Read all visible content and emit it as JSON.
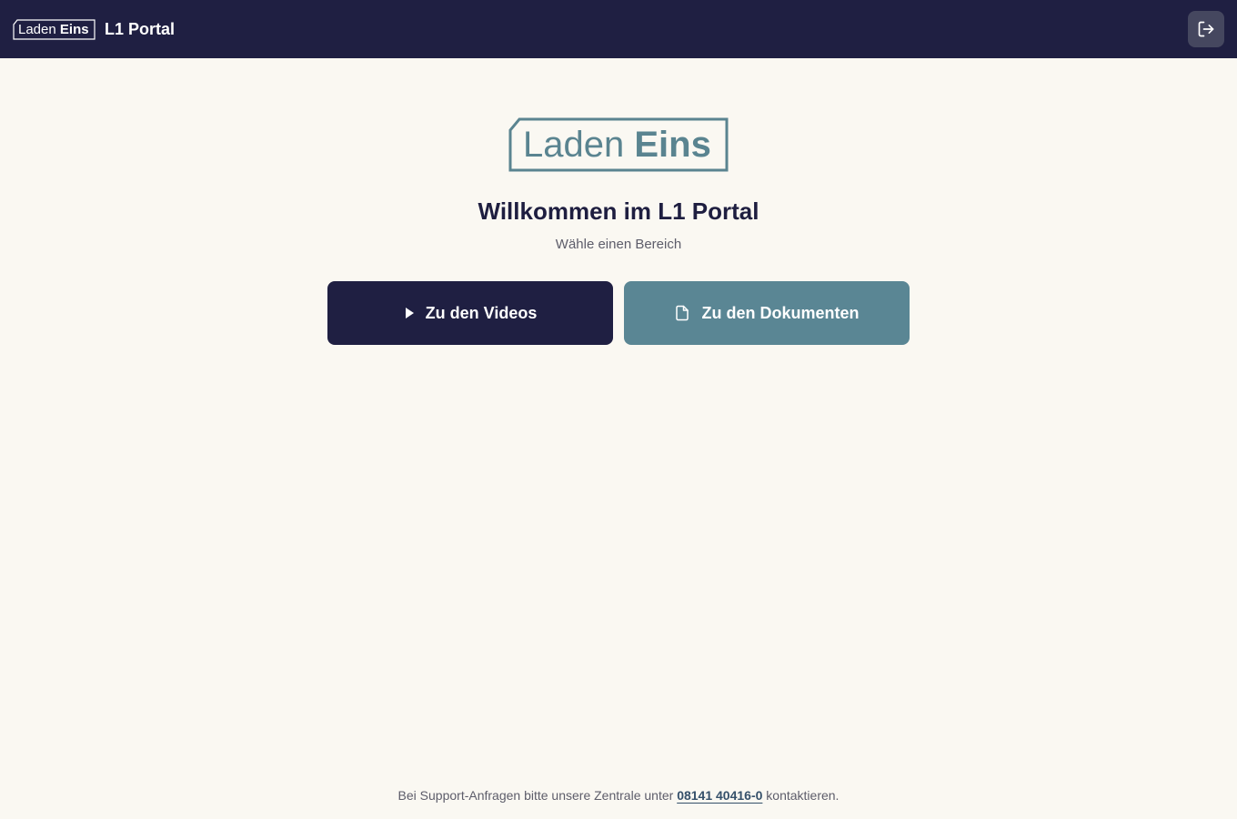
{
  "header": {
    "logo_text_light": "Laden",
    "logo_text_bold": "Eins",
    "app_title": "L1 Portal",
    "logout_icon": "logout-icon"
  },
  "main": {
    "logo_text_light": "Laden",
    "logo_text_bold": "Eins",
    "welcome": "Willkommen im L1 Portal",
    "subtitle": "Wähle einen Bereich",
    "videos_button": {
      "label": "Zu den Videos",
      "icon": "play-icon"
    },
    "docs_button": {
      "label": "Zu den Dokumenten",
      "icon": "document-icon"
    }
  },
  "footer": {
    "text_before": "Bei Support-Anfragen bitte unsere Zentrale unter",
    "phone": "08141 40416-0",
    "text_after": "kontaktieren."
  },
  "colors": {
    "navy": "#1f1f42",
    "teal": "#5a8694",
    "background": "#faf8f2"
  }
}
